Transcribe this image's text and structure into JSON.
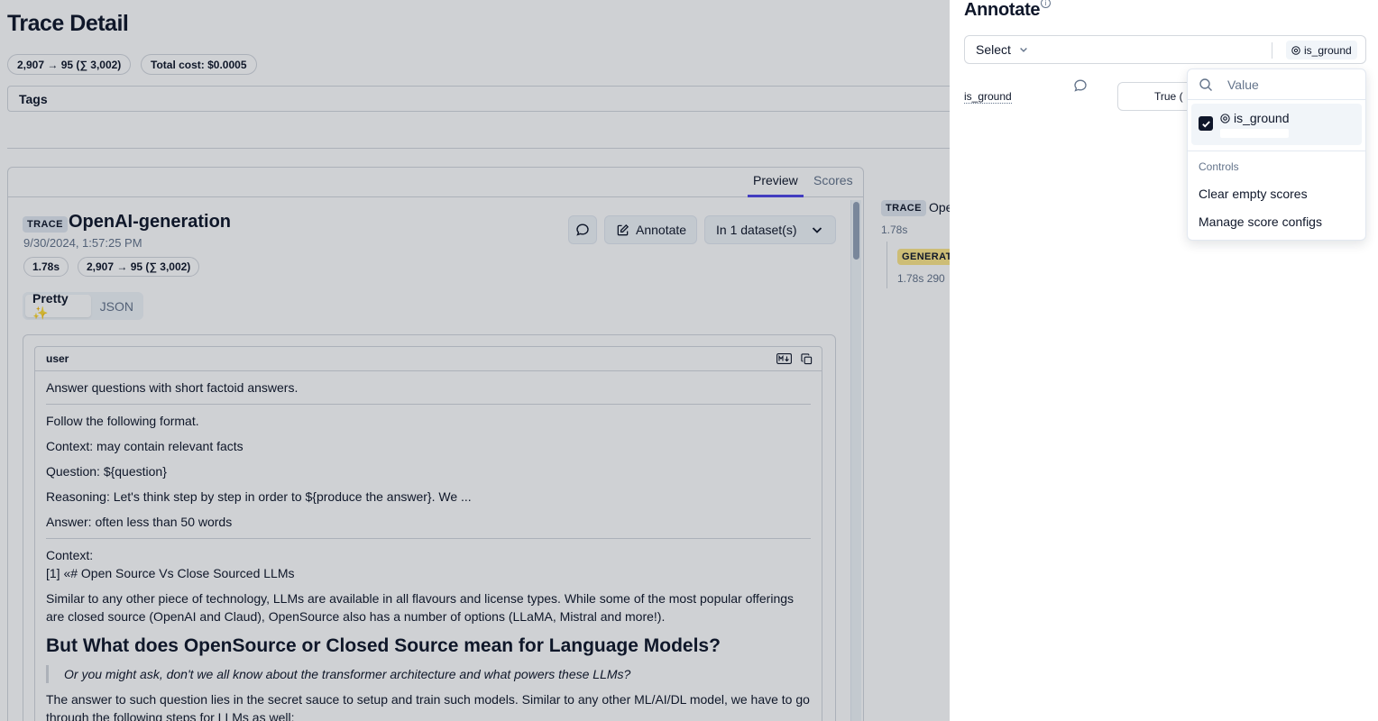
{
  "page": {
    "title": "Trace Detail",
    "usage_pill": "2,907 → 95 (∑ 3,002)",
    "cost_pill": "Total cost: $0.0005",
    "tags_label": "Tags"
  },
  "card": {
    "tabs": [
      "Preview",
      "Scores"
    ],
    "trace_badge": "TRACE",
    "trace_name": "OpenAI-generation",
    "timestamp": "9/30/2024, 1:57:25 PM",
    "latency": "1.78s",
    "tokens": "2,907 → 95 (∑ 3,002)",
    "annotate_label": "Annotate",
    "dataset_label": "In 1 dataset(s)",
    "view_toggle": {
      "pretty": "Pretty ✨",
      "json": "JSON"
    }
  },
  "message": {
    "role": "user",
    "lines": {
      "l1": "Answer questions with short factoid answers.",
      "l2": "Follow the following format.",
      "l3": "Context: may contain relevant facts",
      "l4": "Question: ${question}",
      "l5": "Reasoning: Let's think step by step in order to ${produce the answer}. We ...",
      "l6": "Answer: often less than 50 words",
      "l7": "Context:",
      "l8": "[1] «# Open Source Vs Close Sourced LLMs",
      "l9": "Similar to any other piece of technology, LLMs are available in all flavours and license types. While some of the most popular offerings are closed source (OpenAI and Claud), OpenSource also has a number of options (LLaMA, Mistral and more!).",
      "h1": "But What does OpenSource or Closed Source mean for Language Models?",
      "quote": "Or you might ask, don't we all know about the transformer architecture and what powers these LLMs?",
      "l10": "The answer to such question lies in the secret sauce to setup and train such models. Similar to any other ML/AI/DL model, we have to go through the following steps for LLMs as well:"
    }
  },
  "tree": {
    "trace_badge": "TRACE",
    "trace_name": "Ope",
    "trace_latency": "1.78s",
    "gen_badge": "GENERATI",
    "gen_meta": "1.78s  290"
  },
  "annotate": {
    "title": "Annotate",
    "select_label": "Select",
    "chip_label": "is_ground",
    "score_name": "is_ground",
    "value_display": "True (",
    "dropdown": {
      "search_placeholder": "Value",
      "option_label": "is_ground",
      "controls_heading": "Controls",
      "actions": [
        "Clear empty scores",
        "Manage score configs"
      ]
    }
  },
  "colors": {
    "accent": "#4f46e5",
    "generation_badge": "#fde68a",
    "trace_badge": "#e2e8f0"
  }
}
